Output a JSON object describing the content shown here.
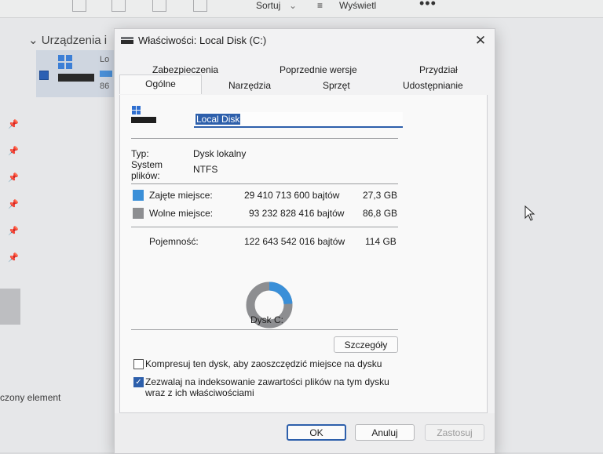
{
  "explorer": {
    "toolbar": {
      "sort_label": "Sortuj",
      "view_label": "Wyświetl",
      "more_label": "•••"
    },
    "group_header": "Urządzenia i",
    "tile": {
      "label": "Lo",
      "number": "86"
    },
    "status": "czony element"
  },
  "dialog": {
    "title": "Właściwości: Local Disk (C:)",
    "close_label": "✕",
    "tabs_row1": [
      "Zabezpieczenia",
      "Poprzednie wersje",
      "Przydział"
    ],
    "tabs_row2": [
      "Ogólne",
      "Narzędzia",
      "Sprzęt",
      "Udostępnianie"
    ],
    "active_tab": "Ogólne",
    "drive_name": "Local Disk",
    "type_label": "Typ:",
    "type_value": "Dysk lokalny",
    "fs_label_1": "System",
    "fs_label_2": "plików:",
    "fs_value": "NTFS",
    "used": {
      "label": "Zajęte miejsce:",
      "bytes": "29 410 713 600 bajtów",
      "size": "27,3 GB",
      "color": "#3a8fd8"
    },
    "free": {
      "label": "Wolne miejsce:",
      "bytes": "93 232 828 416 bajtów",
      "size": "86,8 GB",
      "color": "#8d8e91"
    },
    "capacity": {
      "label": "Pojemność:",
      "bytes": "122 643 542 016 bajtów",
      "size": "114 GB"
    },
    "used_fraction": 0.24,
    "drive_caption": "Dysk C:",
    "details_label": "Szczegóły",
    "compress_label": "Kompresuj ten dysk, aby zaoszczędzić miejsce na dysku",
    "compress_checked": false,
    "index_label_1": "Zezwalaj na indeksowanie zawartości plików na tym dysku",
    "index_label_2": "wraz z ich właściwościami",
    "index_checked": true,
    "ok_label": "OK",
    "cancel_label": "Anuluj",
    "apply_label": "Zastosuj"
  }
}
